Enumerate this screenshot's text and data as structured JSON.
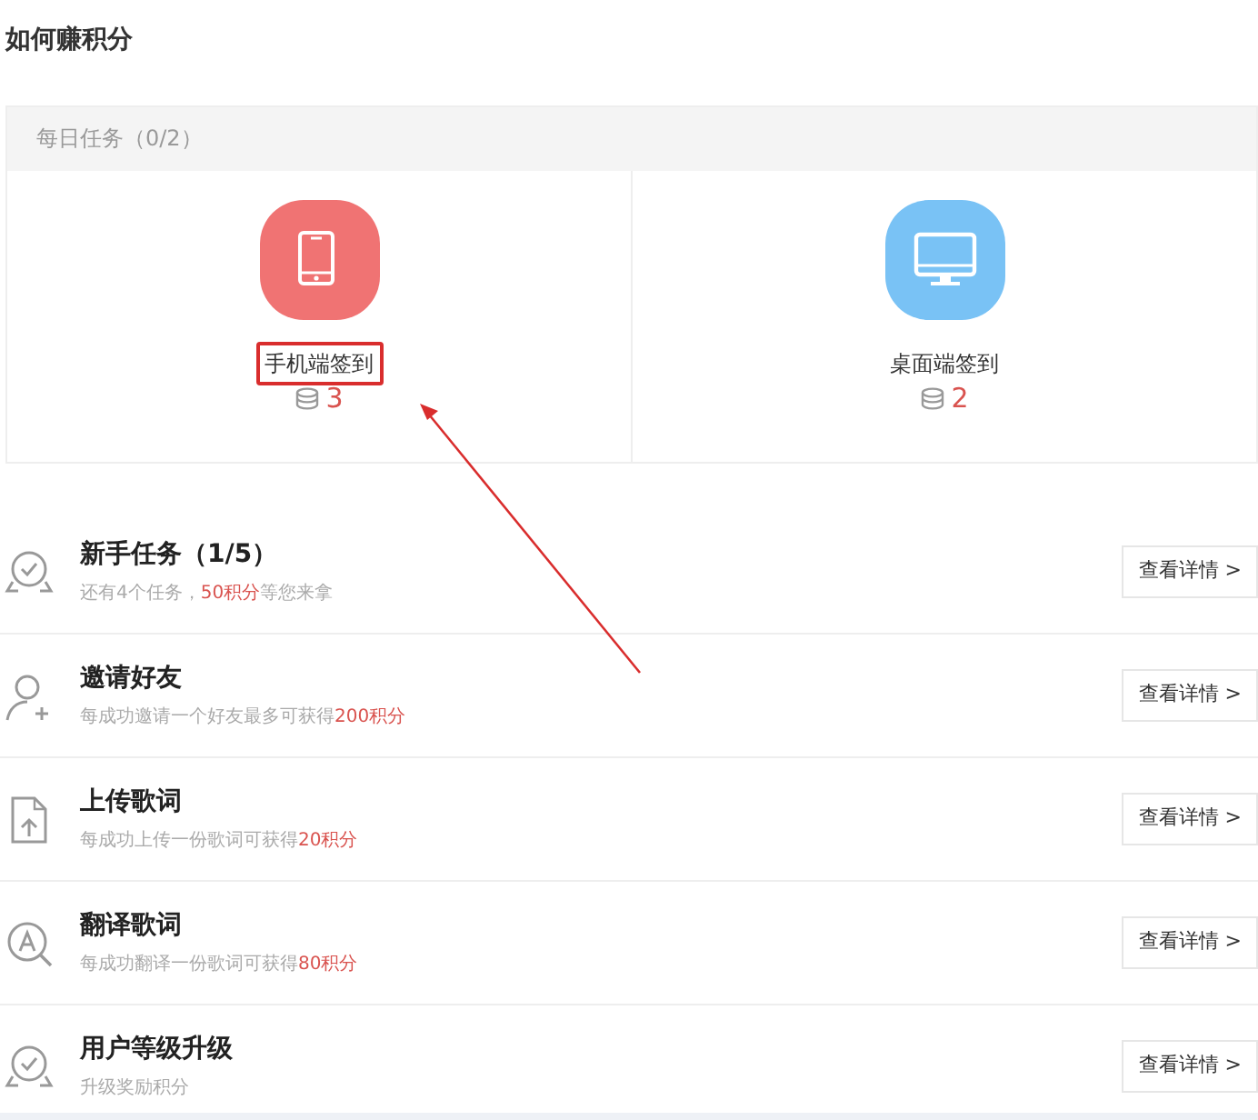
{
  "title": "如何赚积分",
  "daily": {
    "header": "每日任务（0/2）",
    "items": [
      {
        "kind": "phone",
        "label": "手机端签到",
        "points": "3",
        "color": "#f07373",
        "highlighted": true
      },
      {
        "kind": "desktop",
        "label": "桌面端签到",
        "points": "2",
        "color": "#79c2f5",
        "highlighted": false
      }
    ]
  },
  "tasks": [
    {
      "kind": "badge",
      "title": "新手任务（1/5）",
      "desc": [
        {
          "text": "还有4个任务，"
        },
        {
          "text": "50积分",
          "highlight": true
        },
        {
          "text": "等您来拿"
        }
      ],
      "button": "查看详情 >"
    },
    {
      "kind": "invite",
      "title": "邀请好友",
      "desc": [
        {
          "text": "每成功邀请一个好友最多可获得"
        },
        {
          "text": "200积分",
          "highlight": true
        }
      ],
      "button": "查看详情 >"
    },
    {
      "kind": "upload",
      "title": "上传歌词",
      "desc": [
        {
          "text": "每成功上传一份歌词可获得"
        },
        {
          "text": "20积分",
          "highlight": true
        }
      ],
      "button": "查看详情 >"
    },
    {
      "kind": "translate",
      "title": "翻译歌词",
      "desc": [
        {
          "text": "每成功翻译一份歌词可获得"
        },
        {
          "text": "80积分",
          "highlight": true
        }
      ],
      "button": "查看详情 >"
    },
    {
      "kind": "badge",
      "title": "用户等级升级",
      "desc": [
        {
          "text": "升级奖励积分"
        }
      ],
      "button": "查看详情 >"
    }
  ]
}
